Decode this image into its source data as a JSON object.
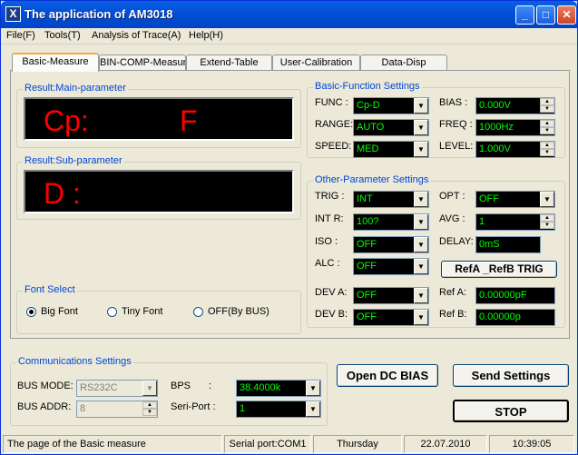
{
  "window": {
    "title": "The application of AM3018",
    "icon_letter": "X"
  },
  "titlebar_buttons": {
    "minimize": "_",
    "maximize": "□",
    "close": "✕"
  },
  "menu": [
    "File(F)",
    "Tools(T)",
    "Analysis of Trace(A)",
    "Help(H)"
  ],
  "tabs": [
    "Basic-Measure",
    "BIN-COMP-Measur",
    "Extend-Table",
    "User-Calibration",
    "Data-Disp"
  ],
  "result_main": {
    "legend": "Result:Main-parameter",
    "param": "Cp:",
    "unit": "F"
  },
  "result_sub": {
    "legend": "Result:Sub-parameter",
    "param": "D :"
  },
  "font_select": {
    "legend": "Font Select",
    "options": [
      "Big Font",
      "Tiny Font",
      "OFF(By BUS)"
    ],
    "selected": "Big Font"
  },
  "basic_function": {
    "legend": "Basic-Function Settings",
    "func_label": "FUNC :",
    "func_value": "Cp-D",
    "range_label": "RANGE:",
    "range_value": "AUTO",
    "speed_label": "SPEED:",
    "speed_value": "MED",
    "bias_label": "BIAS :",
    "bias_value": "0.000V",
    "freq_label": "FREQ :",
    "freq_value": "1000Hz",
    "level_label": "LEVEL:",
    "level_value": "1.000V"
  },
  "other_params": {
    "legend": "Other-Parameter Settings",
    "trig_label": "TRIG :",
    "trig_value": "INT",
    "intr_label": "INT R:",
    "intr_value": "100?",
    "iso_label": "ISO  :",
    "iso_value": "OFF",
    "alc_label": "ALC  :",
    "alc_value": "OFF",
    "opt_label": "OPT  :",
    "opt_value": "OFF",
    "avg_label": "AVG  :",
    "avg_value": "1",
    "delay_label": "DELAY:",
    "delay_value": "0mS",
    "refab_button": "RefA _RefB TRIG",
    "deva_label": "DEV A:",
    "deva_value": "OFF",
    "devb_label": "DEV B:",
    "devb_value": "OFF",
    "refa_label": "Ref A:",
    "refa_value": "0.00000pF",
    "refb_label": "Ref B:",
    "refb_value": "0.00000p"
  },
  "communications": {
    "legend": "Communications Settings",
    "bus_mode_label": "BUS MODE:",
    "bus_mode_value": "RS232C",
    "bus_addr_label": "BUS ADDR:",
    "bus_addr_value": "8",
    "bps_label": "BPS",
    "bps_colon": ":",
    "bps_value": "38.4000k",
    "seriport_label": "Seri-Port :",
    "seriport_value": "1"
  },
  "buttons": {
    "open_dc_bias": "Open DC BIAS",
    "send_settings": "Send Settings",
    "stop": "STOP"
  },
  "status": {
    "page": "The page of the Basic measure",
    "port": "Serial port:COM1",
    "day": "Thursday",
    "date": "22.07.2010",
    "time": "10:39:05"
  }
}
